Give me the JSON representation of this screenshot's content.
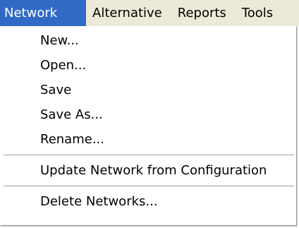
{
  "menubar": {
    "items": [
      {
        "label": "Network"
      },
      {
        "label": "Alternative"
      },
      {
        "label": "Reports"
      },
      {
        "label": "Tools"
      }
    ]
  },
  "menu": {
    "items": [
      {
        "label": "New..."
      },
      {
        "label": "Open..."
      },
      {
        "label": "Save"
      },
      {
        "label": "Save As..."
      },
      {
        "label": "Rename..."
      },
      {
        "label": "Update Network from Configuration"
      },
      {
        "label": "Delete Networks..."
      }
    ]
  },
  "colors": {
    "selection": "#316ac5",
    "menubar_bg": "#ece9d8",
    "menu_bg": "#ffffff"
  }
}
